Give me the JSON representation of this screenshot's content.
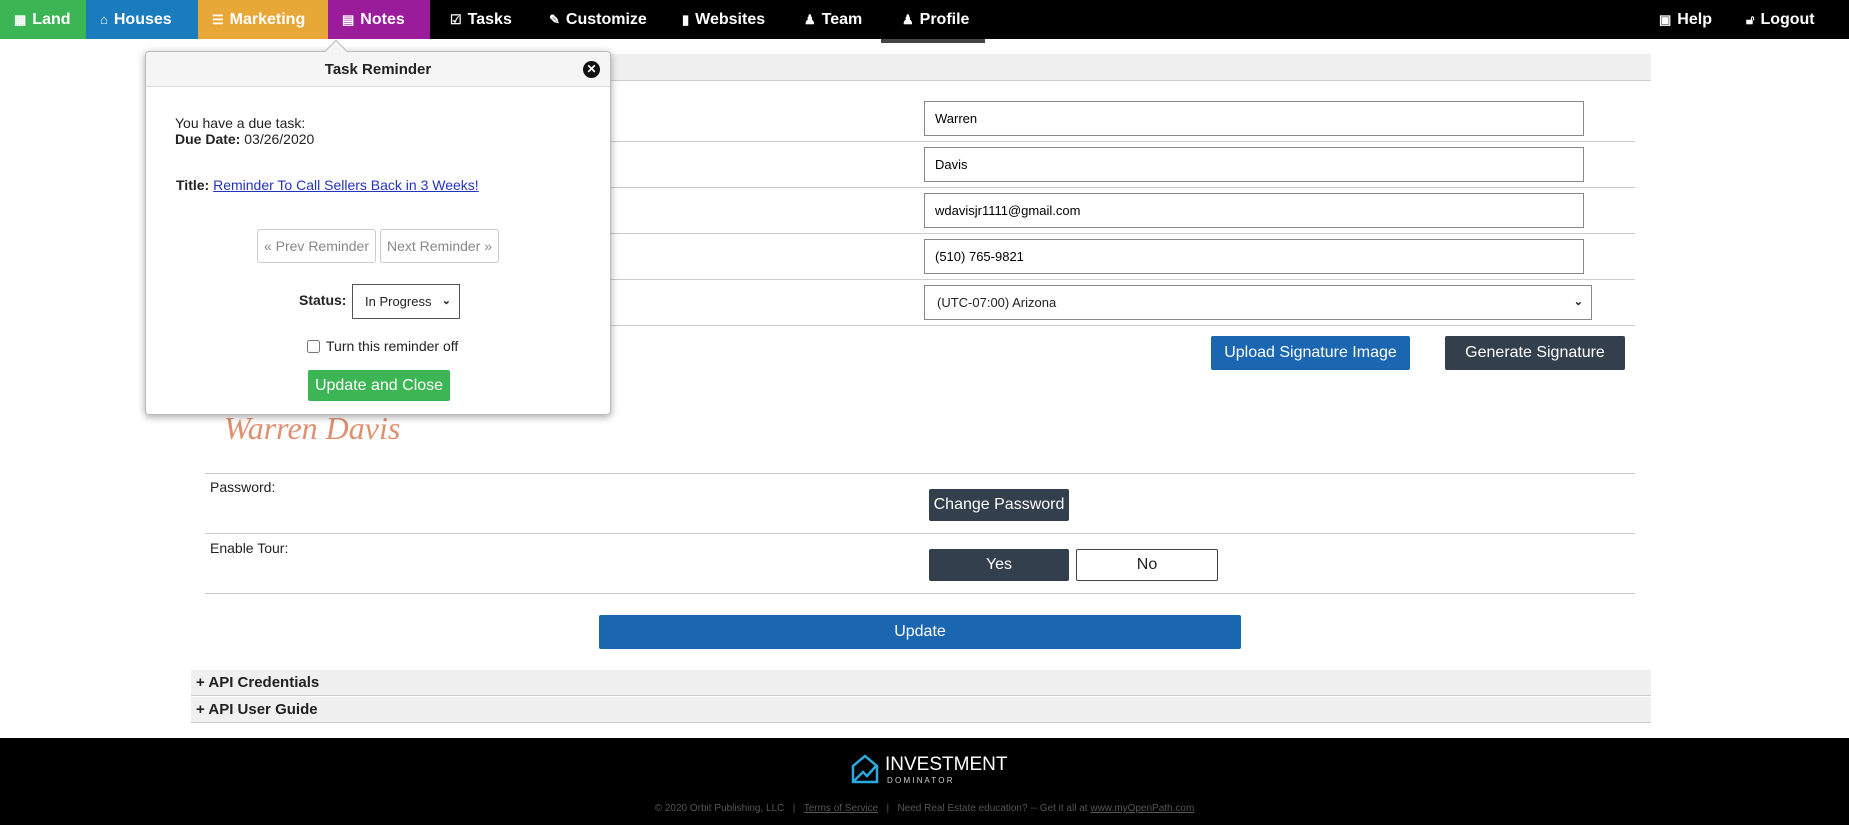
{
  "nav": {
    "items": [
      {
        "label": "Land",
        "icon": "grid-icon",
        "color": "#3cb554"
      },
      {
        "label": "Houses",
        "icon": "house-icon",
        "color": "#1a7bbd"
      },
      {
        "label": "Marketing",
        "icon": "list-icon",
        "color": "#e8a838"
      },
      {
        "label": "Notes",
        "icon": "notes-icon",
        "color": "#9b1c9b"
      },
      {
        "label": "Tasks",
        "icon": "clipboard-icon"
      },
      {
        "label": "Customize",
        "icon": "pencil-icon"
      },
      {
        "label": "Websites",
        "icon": "document-icon"
      },
      {
        "label": "Team",
        "icon": "add-user-icon"
      },
      {
        "label": "Profile",
        "icon": "user-icon"
      }
    ],
    "help": "Help",
    "logout": "Logout"
  },
  "form": {
    "first_name": "Warren",
    "last_name": "Davis",
    "email": "wdavisjr1111@gmail.com",
    "phone": "(510) 765-9821",
    "timezone": "(UTC-07:00) Arizona",
    "upload_signature": "Upload Signature Image",
    "generate_signature": "Generate Signature",
    "signature_text": "Warren Davis",
    "password_label": "Password:",
    "change_password": "Change Password",
    "tour_label": "Enable Tour:",
    "yes": "Yes",
    "no": "No",
    "update": "Update"
  },
  "accordions": [
    "+ API Credentials",
    "+ API User Guide"
  ],
  "popup": {
    "title": "Task Reminder",
    "intro": "You have a due task:",
    "due_label": "Due Date:",
    "due_date": "03/26/2020",
    "title_label": "Title:",
    "task_title": "Reminder To Call Sellers Back in 3 Weeks!",
    "prev": "« Prev Reminder",
    "next": "Next Reminder »",
    "status_label": "Status:",
    "status": "In Progress",
    "turn_off": "Turn this reminder off",
    "update_close": "Update and Close"
  },
  "footer": {
    "brand": "INVESTMENT",
    "brand_sub": "D O M I N A T O R",
    "copyright": "© 2020 Orbit Publishing, LLC",
    "sep": "|",
    "terms": "Terms of Service",
    "edu": "Need Real Estate education? -- Get it all at",
    "edu_link": "www.myOpenPath.com"
  }
}
